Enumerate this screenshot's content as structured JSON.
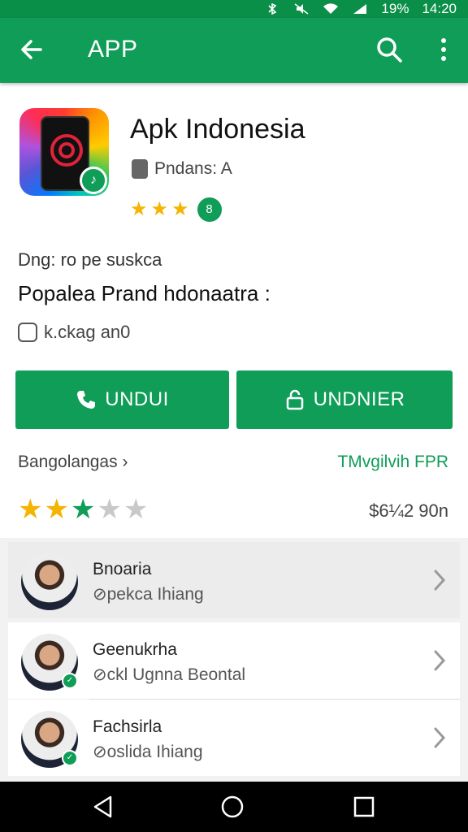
{
  "status_bar": {
    "battery": "19%",
    "time": "14:20"
  },
  "app_bar": {
    "title": "APP",
    "back_icon": "arrow-left-icon",
    "search_icon": "search-icon",
    "more_icon": "more-vert-icon"
  },
  "app": {
    "name": "Apk Indonesia",
    "developer": "Pndans: A",
    "rating_stars": 2.5,
    "badge_text": "8",
    "icon_badge_text": "♪"
  },
  "details": {
    "line1": "Dng: ro pe suskca",
    "line2": "Popalea Prand hdonaatra :",
    "line3": "k.ckag an0"
  },
  "buttons": {
    "left_label": "UNDUI",
    "right_label": "UNDNIER"
  },
  "section": {
    "left": "Bangolangas ›",
    "right": "TMvgilvih FPR"
  },
  "big_rating": {
    "value": 3.5,
    "count": "$6¼2 90n"
  },
  "list": [
    {
      "name": "Bnoaria",
      "subtitle": "⊘pekca Ihiang"
    },
    {
      "name": "Geenukrha",
      "subtitle": "⊘ckl Ugnna Beontal"
    },
    {
      "name": "Fachsirla",
      "subtitle": "⊘oslida Ihiang"
    }
  ],
  "colors": {
    "brand": "#0f9d58",
    "status": "#0a8f48",
    "star": "#f4b400"
  }
}
